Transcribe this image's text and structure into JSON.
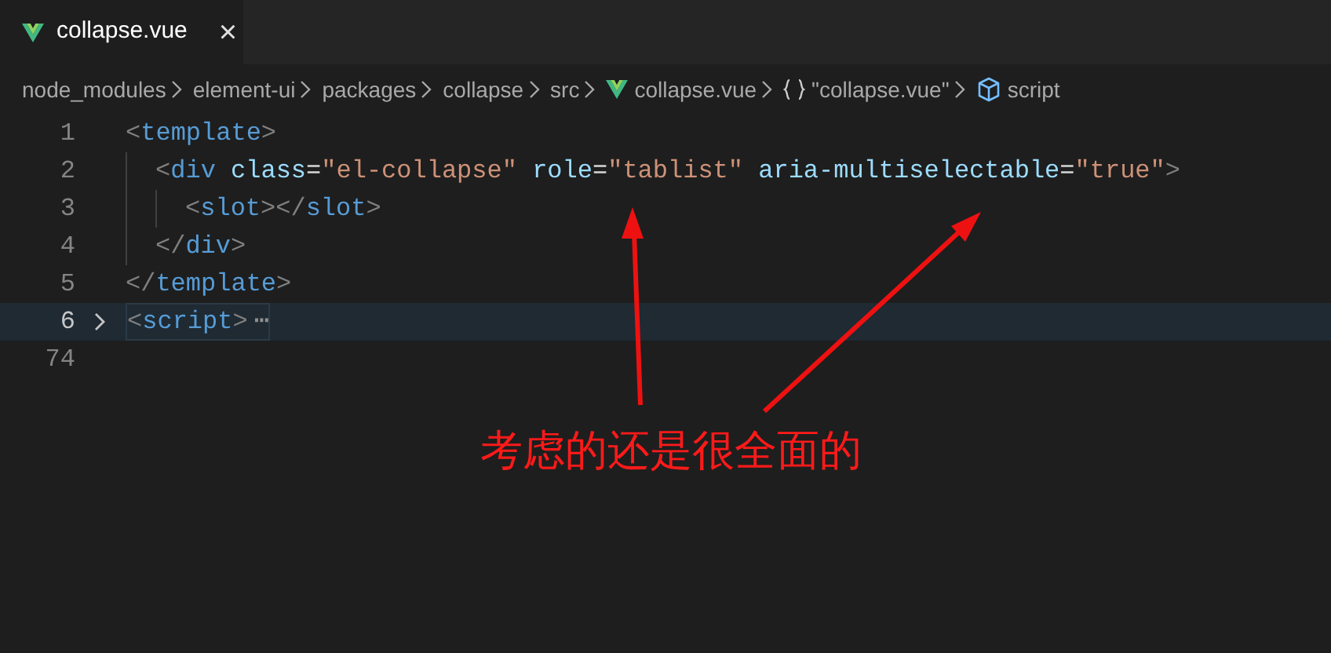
{
  "tab": {
    "label": "collapse.vue",
    "close": "×",
    "selected": true
  },
  "breadcrumbs": [
    {
      "label": "node_modules",
      "kind": "folder"
    },
    {
      "label": "element-ui",
      "kind": "folder"
    },
    {
      "label": "packages",
      "kind": "folder"
    },
    {
      "label": "collapse",
      "kind": "folder"
    },
    {
      "label": "src",
      "kind": "folder"
    },
    {
      "label": "collapse.vue",
      "kind": "vue"
    },
    {
      "label": "\"collapse.vue\"",
      "kind": "module"
    },
    {
      "label": "script",
      "kind": "element"
    }
  ],
  "code": [
    {
      "number": "1",
      "current": false,
      "folded": false,
      "tokens": [
        {
          "kind": "punct",
          "text": "<"
        },
        {
          "kind": "tag",
          "text": "template"
        },
        {
          "kind": "punct",
          "text": ">"
        }
      ],
      "children": [
        {
          "number": "2",
          "current": false,
          "folded": false,
          "tokens": [
            {
              "kind": "punct",
              "text": "<"
            },
            {
              "kind": "tag",
              "text": "div"
            },
            {
              "kind": "attr",
              "text": " class"
            },
            {
              "kind": "plain",
              "text": "="
            },
            {
              "kind": "string",
              "text": "\"el-collapse\""
            },
            {
              "kind": "attr",
              "text": " role"
            },
            {
              "kind": "plain",
              "text": "="
            },
            {
              "kind": "string",
              "text": "\"tablist\""
            },
            {
              "kind": "attr",
              "text": " aria-multiselectable"
            },
            {
              "kind": "plain",
              "text": "="
            },
            {
              "kind": "string",
              "text": "\"true\""
            },
            {
              "kind": "punct",
              "text": ">"
            }
          ],
          "children": [
            {
              "number": "3",
              "current": false,
              "folded": false,
              "tokens": [
                {
                  "kind": "punct",
                  "text": "<"
                },
                {
                  "kind": "tag",
                  "text": "slot"
                },
                {
                  "kind": "punct",
                  "text": "></"
                },
                {
                  "kind": "tag",
                  "text": "slot"
                },
                {
                  "kind": "punct",
                  "text": ">"
                }
              ]
            }
          ]
        },
        {
          "number": "4",
          "current": false,
          "folded": false,
          "tokens": [
            {
              "kind": "punct",
              "text": "</"
            },
            {
              "kind": "tag",
              "text": "div"
            },
            {
              "kind": "punct",
              "text": ">"
            }
          ]
        }
      ]
    },
    {
      "number": "5",
      "current": false,
      "folded": false,
      "tokens": [
        {
          "kind": "punct",
          "text": "</"
        },
        {
          "kind": "tag",
          "text": "template"
        },
        {
          "kind": "punct",
          "text": ">"
        }
      ]
    },
    {
      "number": "6",
      "current": true,
      "folded": true,
      "fold_marker": "⋯",
      "tokens": [
        {
          "kind": "punct",
          "text": "<"
        },
        {
          "kind": "tag",
          "text": "script"
        },
        {
          "kind": "punct",
          "text": ">"
        }
      ]
    },
    {
      "number": "74",
      "current": false,
      "folded": false
    }
  ],
  "annotation": {
    "text": "考虑的还是很全面的"
  }
}
